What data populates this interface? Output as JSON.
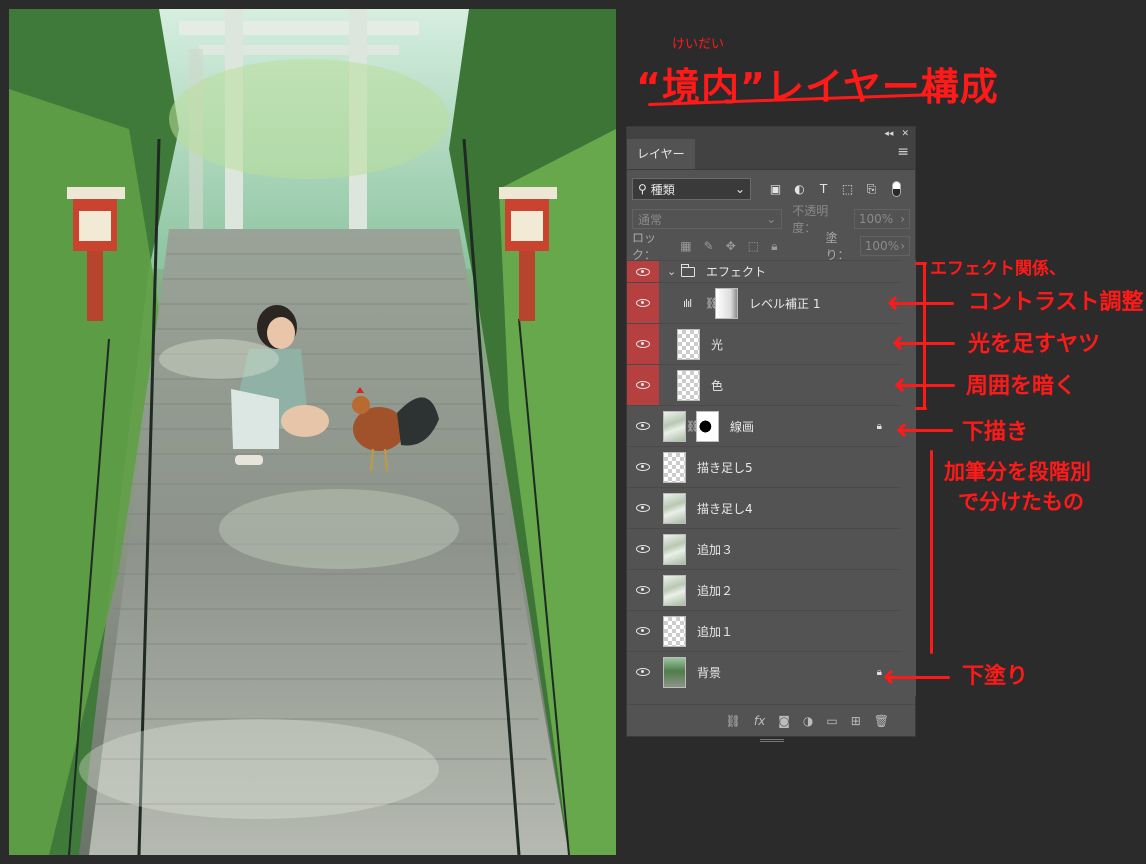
{
  "annotations": {
    "title": "“境内”レイヤー構成",
    "title_furigana": "けいだい",
    "effects_group": "エフェクト関係、",
    "contrast": "コントラスト調整",
    "light": "光を足すヤツ",
    "darken": "周囲を暗く",
    "sketch": "下描き",
    "paint_line1": "加筆分を段階別",
    "paint_line2": "で分けたもの",
    "base": "下塗り"
  },
  "panel": {
    "tab": "レイヤー",
    "menu_icon": "hamburger-menu-icon",
    "kind_filter": "種類",
    "blend_mode": "通常",
    "opacity_label": "不透明度：",
    "opacity_value": "100%",
    "lock_label": "ロック：",
    "fill_label": "塗り：",
    "fill_value": "100%",
    "colors": {
      "panel_bg": "#535353",
      "fx_highlight": "#b63f3f",
      "annotation": "#ff1a1a"
    }
  },
  "layers": [
    {
      "name": "エフェクト",
      "type": "group"
    },
    {
      "name": "レベル補正 1",
      "type": "adjustment"
    },
    {
      "name": "光",
      "type": "pixel"
    },
    {
      "name": "色",
      "type": "pixel"
    },
    {
      "name": "線画",
      "type": "pixel-mask",
      "locked": true
    },
    {
      "name": "描き足し5",
      "type": "pixel"
    },
    {
      "name": "描き足し4",
      "type": "pixel"
    },
    {
      "name": "追加３",
      "type": "pixel"
    },
    {
      "name": "追加２",
      "type": "pixel"
    },
    {
      "name": "追加１",
      "type": "pixel"
    },
    {
      "name": "背景",
      "type": "background",
      "locked": true
    }
  ]
}
